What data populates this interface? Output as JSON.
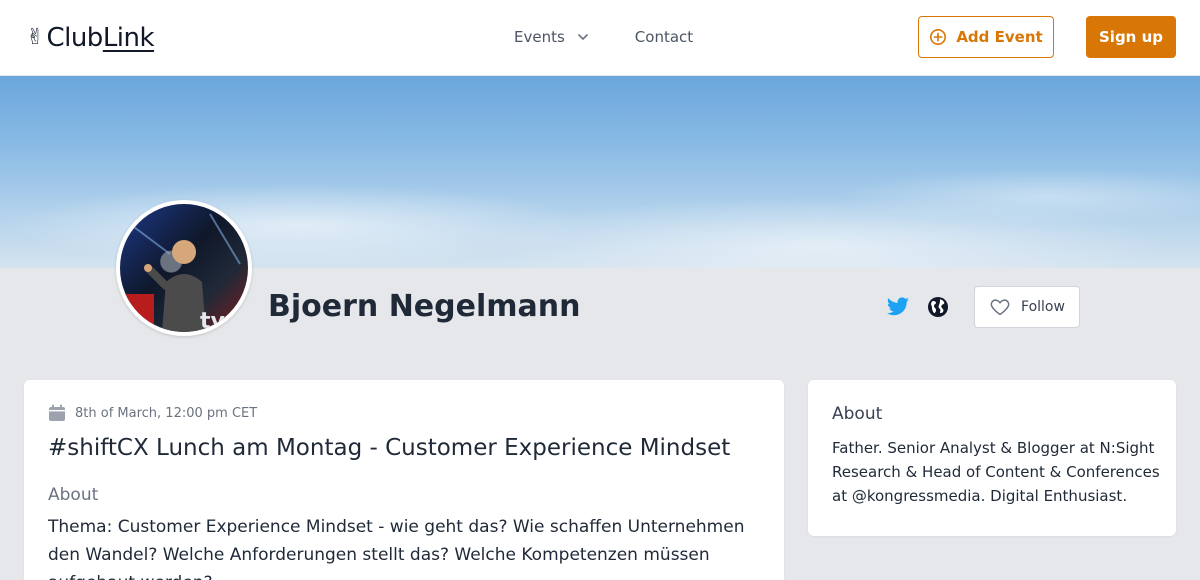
{
  "header": {
    "logo_emoji": "✌",
    "logo_text_a": "Club",
    "logo_text_b": "Link",
    "nav": {
      "events_label": "Events",
      "contact_label": "Contact"
    },
    "add_event_label": "Add Event",
    "signup_label": "Sign up"
  },
  "profile": {
    "name": "Bjoern Negelmann",
    "follow_label": "Follow",
    "icons": [
      "twitter-icon",
      "globe-icon",
      "heart-icon"
    ]
  },
  "event": {
    "date": "8th of March, 12:00 pm CET",
    "title": "#shiftCX Lunch am Montag - Customer Experience Mindset",
    "about_label": "About",
    "description": "Thema: Customer Experience Mindset - wie geht das? Wie schaffen Unternehmen den Wandel? Welche Anforderungen stellt das? Welche Kompetenzen müssen aufgebaut werden?"
  },
  "about": {
    "label": "About",
    "text": "Father. Senior Analyst & Blogger at N:Sight Research & Head of Content & Conferences at @kongressmedia. Digital Enthusiast."
  },
  "colors": {
    "accent": "#d97706",
    "twitter": "#1da1f2",
    "page_bg": "#e5e7eb"
  }
}
